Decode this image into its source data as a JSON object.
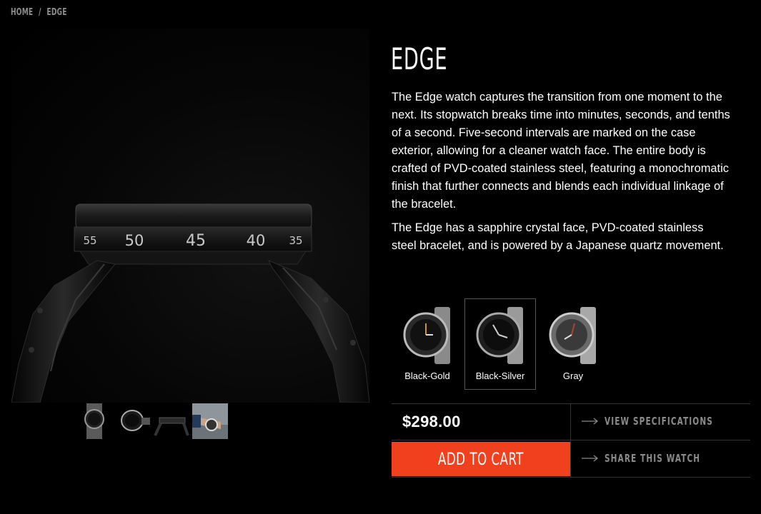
{
  "breadcrumb": {
    "items": [
      "HOME",
      "EDGE"
    ],
    "separator": "/"
  },
  "product": {
    "title": "EDGE",
    "description": [
      "The Edge watch captures the transition from one moment to the next. Its stopwatch breaks time into minutes, seconds, and tenths of a second. Five-second intervals are marked on the case exterior, allowing for a cleaner watch face. The entire body is crafted of PVD-coated stainless steel, featuring a monochromatic finish that further connects and blends each individual linkage of the bracelet.",
      "The Edge has a sapphire crystal face, PVD-coated stainless steel bracelet, and is powered by a Japanese quartz movement."
    ],
    "price": "$298.00",
    "case_numbers": [
      "55",
      "50",
      "45",
      "40",
      "35"
    ]
  },
  "colors": {
    "options": [
      {
        "label": "Black-Gold",
        "accent": "#c8962e",
        "case": "#2a2a2a",
        "band": "#8a8a8a"
      },
      {
        "label": "Black-Silver",
        "accent": "#d0d0d0",
        "case": "#1e1e1e",
        "band": "#9a9a9a"
      },
      {
        "label": "Gray",
        "accent": "#b04030",
        "case": "#6a6a6a",
        "band": "#a8a8a8"
      }
    ],
    "selected_index": 1
  },
  "gallery": {
    "thumbnails": [
      "front-view-thumb",
      "angled-view-thumb",
      "side-view-thumb",
      "wrist-view-thumb"
    ]
  },
  "actions": {
    "add_to_cart": "ADD TO CART",
    "view_specs": "VIEW SPECIFICATIONS",
    "share": "SHARE THIS WATCH"
  },
  "theme": {
    "background": "#000000",
    "accent": "#f0401e",
    "muted_text": "#8c8c8c",
    "divider": "#333333"
  }
}
